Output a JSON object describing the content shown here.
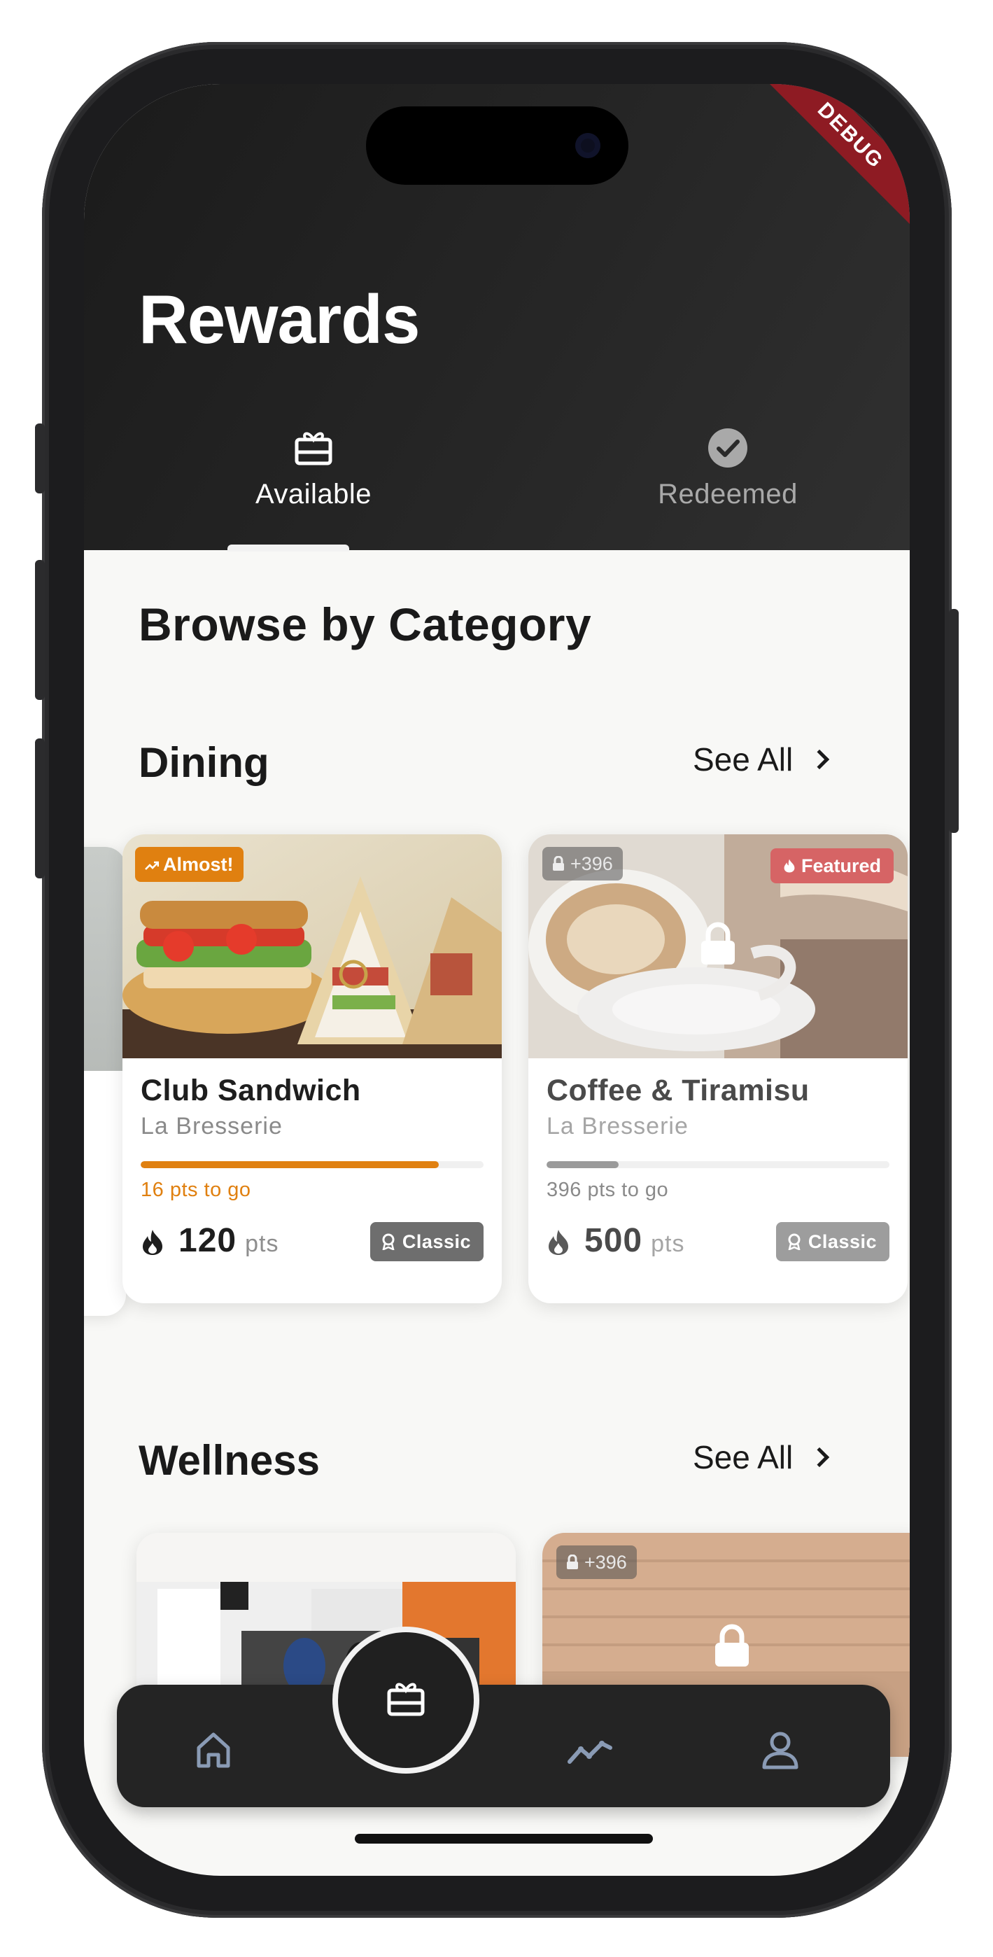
{
  "header": {
    "title": "Rewards",
    "debug_banner": "DEBUG",
    "tabs": [
      {
        "label": "Available",
        "icon": "gift-card-icon",
        "selected": true
      },
      {
        "label": "Redeemed",
        "icon": "check-circle-icon",
        "selected": false
      }
    ]
  },
  "main": {
    "browse_title": "Browse by Category",
    "sections": [
      {
        "title": "Dining",
        "see_all": "See All",
        "cards": [
          {
            "badge": "Almost!",
            "badge_color": "#e08010",
            "title": "Club Sandwich",
            "subtitle": "La Bresserie",
            "progress": 0.87,
            "progress_color": "#e08010",
            "to_go": "16 pts to go",
            "points": "120",
            "points_unit": "pts",
            "tier": "Classic",
            "locked": false
          },
          {
            "lock_chip": "+396",
            "badge": "Featured",
            "badge_color": "#d66465",
            "title": "Coffee & Tiramisu",
            "subtitle": "La Bresserie",
            "progress": 0.21,
            "progress_color": "#9a9a9a",
            "to_go": "396 pts to go",
            "points": "500",
            "points_unit": "pts",
            "tier": "Classic",
            "locked": true
          }
        ]
      },
      {
        "title": "Wellness",
        "see_all": "See All",
        "cards": [
          {
            "locked": false
          },
          {
            "lock_chip": "+396",
            "locked": true
          }
        ]
      }
    ]
  },
  "nav": {
    "items": [
      "home-icon",
      "rewards-icon",
      "activity-chart-icon",
      "profile-icon"
    ],
    "active": "rewards-icon"
  },
  "colors": {
    "accent_orange": "#e08010",
    "featured_red": "#d66465",
    "dark": "#242424"
  }
}
